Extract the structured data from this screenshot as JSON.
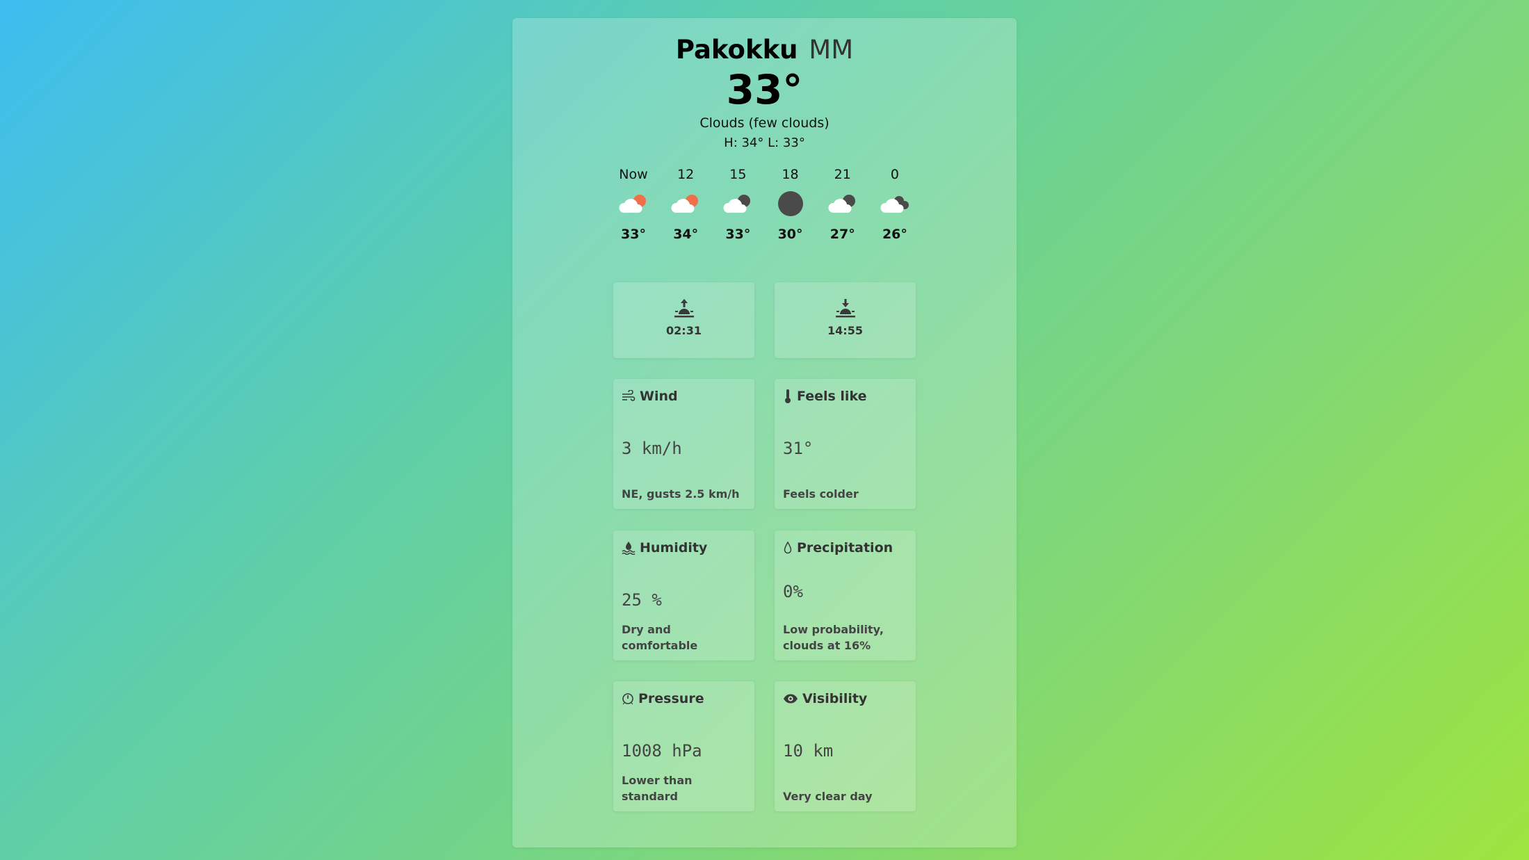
{
  "location": {
    "city": "Pakokku",
    "country": "MM"
  },
  "current": {
    "temp": "33°",
    "description": "Clouds (few clouds)",
    "hilo": "H: 34° L: 33°"
  },
  "hourly": [
    {
      "label": "Now",
      "temp": "33°",
      "icon": "cloud-sun-icon"
    },
    {
      "label": "12",
      "temp": "34°",
      "icon": "cloud-sun-icon"
    },
    {
      "label": "15",
      "temp": "33°",
      "icon": "cloud-moon-icon"
    },
    {
      "label": "18",
      "temp": "30°",
      "icon": "moon-icon"
    },
    {
      "label": "21",
      "temp": "27°",
      "icon": "cloud-moon-icon"
    },
    {
      "label": "0",
      "temp": "26°",
      "icon": "cloudy-night-icon"
    }
  ],
  "sun": {
    "sunrise": "02:31",
    "sunset": "14:55"
  },
  "metrics": {
    "wind": {
      "title": "Wind",
      "value": "3 km/h",
      "note": "NE, gusts 2.5 km/h"
    },
    "feels_like": {
      "title": "Feels like",
      "value": "31°",
      "note": "Feels colder"
    },
    "humidity": {
      "title": "Humidity",
      "value": "25 %",
      "note": "Dry and comfortable"
    },
    "precipitation": {
      "title": "Precipitation",
      "value": "0%",
      "note": "Low probability, clouds at 16%"
    },
    "pressure": {
      "title": "Pressure",
      "value": "1008 hPa",
      "note": "Lower than standard"
    },
    "visibility": {
      "title": "Visibility",
      "value": "10 km",
      "note": "Very clear day"
    }
  },
  "colors": {
    "sun_accent": "#f0704a",
    "moon": "#4a4a4a",
    "cloud": "#ffffff"
  }
}
